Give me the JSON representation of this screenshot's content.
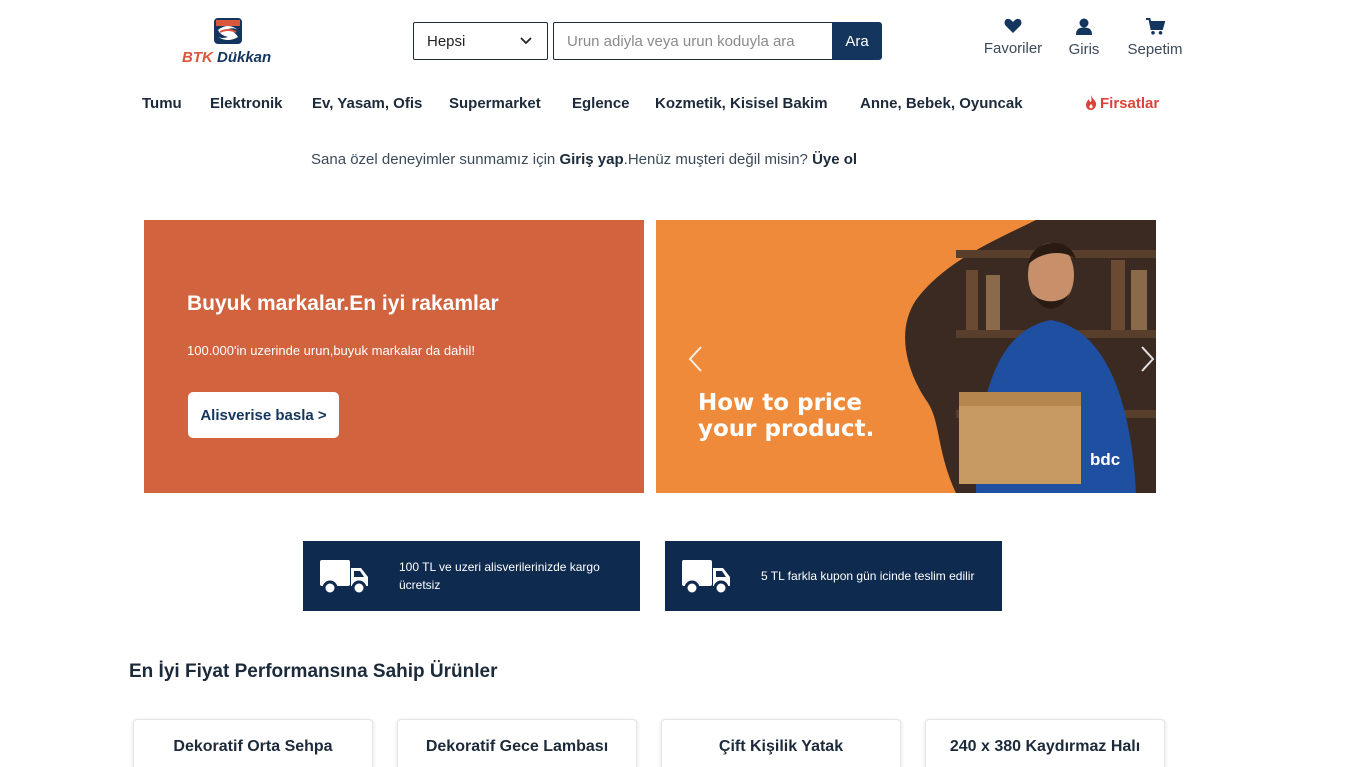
{
  "header": {
    "logo": {
      "part1": "BTK",
      "part2": "Dükkan"
    },
    "category_select": {
      "value": "Hepsi"
    },
    "search": {
      "placeholder": "Urun adiyla veya urun koduyla ara",
      "button_label": "Ara"
    },
    "links": [
      {
        "label": "Favoriler",
        "icon": "heart-icon"
      },
      {
        "label": "Giris",
        "icon": "user-icon"
      },
      {
        "label": "Sepetim",
        "icon": "cart-icon"
      }
    ]
  },
  "nav": {
    "items": [
      "Tumu",
      "Elektronik",
      "Ev, Yasam, Ofis",
      "Supermarket",
      "Eglence",
      "Kozmetik, Kisisel Bakim",
      "Anne, Bebek, Oyuncak"
    ],
    "hot": {
      "label": "Firsatlar",
      "icon": "flame-icon"
    }
  },
  "login_prompt": {
    "text1": "Sana özel deneyimler sunmamız için ",
    "login_link": "Giriş yap",
    "text2": ".Henüz muşteri değil misin? ",
    "signup_link": "Üye ol"
  },
  "hero": {
    "title": "Buyuk markalar.En iyi rakamlar",
    "subtitle": "100.000'in uzerinde urun,buyuk markalar da dahil!",
    "button_label": "Alisverise basla >",
    "bg_color": "#d1633f"
  },
  "carousel": {
    "slide_line1": "How to price",
    "slide_line2": "your product.",
    "brand": "bdc",
    "bg_color": "#ef8a3a"
  },
  "info_cards": [
    {
      "icon": "truck-icon",
      "text": "100 TL ve uzeri alisverilerinizde kargo ücretsiz"
    },
    {
      "icon": "truck-icon",
      "text": "5 TL farkla kupon gün icinde teslim edilir"
    }
  ],
  "products_section": {
    "title": "En İyi Fiyat Performansına Sahip Ürünler",
    "items": [
      {
        "title": "Dekoratif Orta Sehpa"
      },
      {
        "title": "Dekoratif Gece Lambası"
      },
      {
        "title": "Çift Kişilik Yatak"
      },
      {
        "title": "240 x 380 Kaydırmaz Halı"
      }
    ]
  },
  "colors": {
    "primary": "#14365e",
    "accent": "#d9443a",
    "dark_card": "#0f2a4f"
  }
}
